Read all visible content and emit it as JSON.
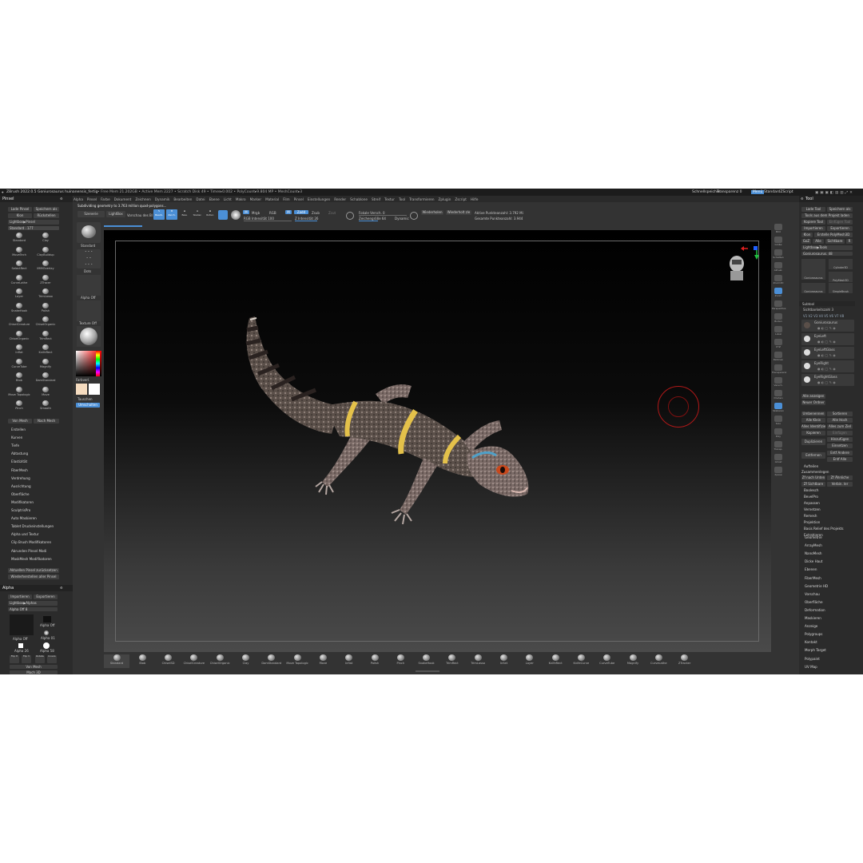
{
  "titlebar": {
    "app": "ZBrush 2022.0.5",
    "doc": "Goniurosaurus huinanensis_fertig",
    "stats": "• Free Mem 21.202GB • Active Mem 2227 • Scratch Disk 49 • Timer▸0.002 • PolyCount▸9.804 MP • MeshCount▸3",
    "quicksave": "Schnellspeicher",
    "transparency": "Transparenz 0",
    "menu": "Menü",
    "script": "StandardZScript"
  },
  "menus": [
    "Alpha",
    "Pinsel",
    "Farbe",
    "Dokument",
    "Zeichnen",
    "Dynamik",
    "Bearbeiten",
    "Datei",
    "Ebene",
    "Licht",
    "Makro",
    "Marker",
    "Material",
    "Film",
    "Pinsel",
    "Einstellungen",
    "Render",
    "Schablone",
    "Streif",
    "Textur",
    "Tool",
    "Transformieren",
    "Zplugin",
    "Zscript",
    "Hilfe"
  ],
  "status_message": "Subdividing geometry to 3.763 million quad-polygons...",
  "toolbar": {
    "scene": "Szenerie",
    "lightbox": "LightBox",
    "preview": "Vorschau des Bl",
    "edit": "Bearb.",
    "draw": "Zeich.",
    "move": "Bew.",
    "scale": "Skalier.",
    "rotate": "Rotier.",
    "mrgb": "Mrgb",
    "rgb": "RGB",
    "m": "M",
    "zadd": "Zadd",
    "zsub": "Zsub",
    "zcut": "Zcut",
    "rgb_intensity": "RGB Intensität 100",
    "z_intensity": "Z Intensität 26",
    "focal_shift": "Fokale Versch. 0",
    "draw_size": "Zeichengröße 64",
    "dynamic": "Dynamic",
    "replay_last": "Wiederholen",
    "replay_last_rel": "Wiederholt zle",
    "active_points": "Aktive Punkteanzahl: 3.792 Mi",
    "total_points": "Gesamte Punkteanzahl: 3.944"
  },
  "left_panel": {
    "title": "Pinsel",
    "load": "Lade Pinsel",
    "save_as": "Speichern als",
    "clone": "Klon",
    "reset": "Rückstellen",
    "lightbox": "Lightbox▶Pinsel",
    "standard": "Standard . 177",
    "brushes": [
      "Standard",
      "Clay",
      "MoveTech",
      "ClayBuildup",
      "SelectRect",
      "IMMOverlay",
      "CurveLathe",
      "ZTracer",
      "Layer",
      "TrimLasso",
      "SnakeHook",
      "Polish",
      "ChiselCreature",
      "ChiselOrganic",
      "ChiselOrganic",
      "TrimRect",
      "Inflat",
      "KnifeRect",
      "CurveTube",
      "Magnify",
      "Blob",
      "DamStandard",
      "Move Topologic",
      "Move",
      "Pinch",
      "Smooth"
    ],
    "bot_left": "Von Mesh",
    "bot_right": "Nach Mesh",
    "sections": [
      "Erstellen",
      "Kurven",
      "Tiefe",
      "Abtastung",
      "Elastizität",
      "FiberMesh",
      "Verdrehung",
      "Ausrichtung",
      "Oberfläche",
      "Modifikatoren",
      "SculptrisPro",
      "Auto Maskieren",
      "Tablet Druckeinstellungen",
      "Alpha und Textur",
      "Clip Brush Modifikatoren",
      "Abrunden Pinsel Modi",
      "MaskMesh Modifikatoren"
    ],
    "reset_brush": "Aktuellen Pinsel zurücksetzen",
    "restore_all": "Wiederherstellen aller Pinsel"
  },
  "alpha_panel": {
    "title": "Alpha",
    "import": "Importieren",
    "export": "Exportieren",
    "lightbox": "Lightbox▶Alphas",
    "alpha_off_label": "Alpha Off 8",
    "alpha_off": "Alpha Off",
    "alpha_01": "Alpha 01",
    "alpha_26": "Alpha 26",
    "alpha_58": "Alpha 58",
    "flip_h": "Flip H",
    "flip_v": "Flip V",
    "rotate": "Rotate",
    "invers": "Invers",
    "mesh": "Von Mesh",
    "make_3d": "Mach 3D"
  },
  "mid_column": {
    "standard": "Standard",
    "dots": "Dots",
    "alpha_off": "Alpha Off",
    "texture_off": "Texture Off",
    "matcap": "MatCap Gray",
    "gradient": "Farbverl.",
    "swap": "Tauschen",
    "alternate": "Umschalten"
  },
  "right_tools": [
    "Bild",
    "Größe",
    "Schatten",
    "Aktual.",
    "Zoom2D",
    "Zoom",
    "Perspektive",
    "Boden",
    "Lokal",
    "XYZ",
    "Rahmen",
    "Transparenz",
    "Versch.",
    "Drehen",
    "Skalieren",
    "Solo",
    "Poly",
    "Transp.",
    "Ghost",
    "Xpose"
  ],
  "tool_panel": {
    "title": "Tool",
    "load": "Lade Tool",
    "save_as": "Speichern als",
    "load_from_project": "Tools aus dem Projekt laden",
    "copy": "Kopiere Tool",
    "paste": "Einfügen Tool",
    "import": "Importieren",
    "export": "Exportieren",
    "clone": "Klon",
    "make_polymesh": "Erstelle PolyMesh3D",
    "goz": "GoZ",
    "all": "Alle",
    "visible": "Sichtbare",
    "r": "R",
    "lightbox": "Lightbox▶Tools",
    "current": "Goniurosaurus. 48",
    "thumbs": [
      "Goniurosaurus",
      "Cylinder3D",
      "PolyMesh3D",
      "Goniurosaurus",
      "SimpleBrush"
    ],
    "subtool": "Subtool",
    "visible_count": "Sichtbarkeitszahl 3",
    "subtools": [
      "Goniurosaurus",
      "EyeLeft",
      "EyeLeftGlass",
      "EyeRight",
      "EyeRightGlass"
    ],
    "list_all": "Alle anzeigen",
    "new_folder": "Neuer Ordner",
    "rename": "Umbenennen",
    "sort": "Sortieren",
    "all_low": "Alle Klein",
    "all_high": "Alle Hoch",
    "duplicate": "Alles Identifizieren",
    "all_to_target": "Alles zum Ziel",
    "copy2": "Kopieren",
    "paste2": "Einfügen",
    "duplicate2": "Duplizieren",
    "append": "Hinzufügen",
    "insert": "Einsetzen",
    "delete": "Entfernen",
    "delete_other": "Entf Andere",
    "delete_all": "Entf Alle",
    "split": "Aufteilen",
    "merge": "Zusammenlegen",
    "merge_down": "Zf nach Unten",
    "merge_similar": "Zf Ähnliche",
    "merge_visible": "Zf Sichtbare",
    "weld": "Verbin. ler",
    "boolean": "Boolesch",
    "bevelpro": "BevelPro",
    "remesh": "Anpassen",
    "project": "Vernetzen",
    "remesh2": "Remesh",
    "projection": "Projektion",
    "extract": "Basis Relief des Projekts",
    "extract2": "Extrahieren",
    "sections": [
      "Geometrie",
      "ArrayMesh",
      "NanoMesh",
      "Dicke Haut",
      "Ebenen",
      "FiberMesh",
      "Geometrie HD",
      "Vorschau",
      "Oberfläche",
      "Deformation",
      "Maskieren",
      "Anzeige",
      "Polygroups",
      "Kontakt",
      "Morph Target",
      "Polypaint",
      "UV Map"
    ]
  },
  "shelf": [
    "Standard",
    "Blob",
    "ChiselSD",
    "ChiselCreature",
    "ChiselOrganic",
    "Clay",
    "DamStandard",
    "Move Topologic",
    "Move",
    "Inflat",
    "Polish",
    "Pinch",
    "SnakeHook",
    "TrimRect",
    "TrimLasso",
    "InSet",
    "Layer",
    "KnifeRect",
    "KnifeCurve",
    "CurveTube",
    "Magnify",
    "CurveLathe",
    "ZTracker"
  ],
  "colors": {
    "accent": "#4b8fd6",
    "panel": "#2b2b2b",
    "background": "#333333",
    "gecko_band": "#e4c14a",
    "cursor": "#b01818"
  }
}
